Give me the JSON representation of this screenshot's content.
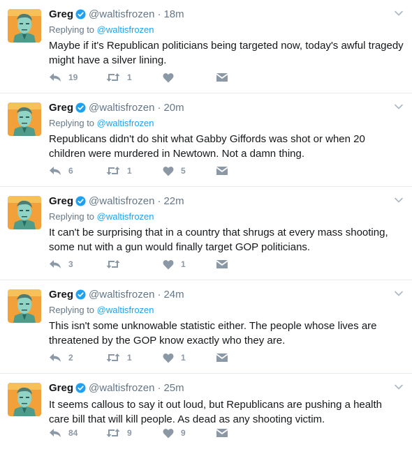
{
  "colors": {
    "link": "#1da1f2",
    "muted": "#657786",
    "action_icon": "#8b98a5",
    "verified": "#1da1f2",
    "divider": "#e6ecf0"
  },
  "tweets": [
    {
      "name": "Greg",
      "handle": "@waltisfrozen",
      "time": "18m",
      "reply_label": "Replying to",
      "reply_to": "@waltisfrozen",
      "text": "Maybe if it's Republican politicians being targeted now, today's awful tragedy might have a silver lining.",
      "replies": "19",
      "retweets": "1",
      "likes": ""
    },
    {
      "name": "Greg",
      "handle": "@waltisfrozen",
      "time": "20m",
      "reply_label": "Replying to",
      "reply_to": "@waltisfrozen",
      "text": "Republicans didn't do shit what Gabby Giffords was shot or when 20 children were murdered in Newtown. Not a damn thing.",
      "replies": "6",
      "retweets": "1",
      "likes": "5"
    },
    {
      "name": "Greg",
      "handle": "@waltisfrozen",
      "time": "22m",
      "reply_label": "Replying to",
      "reply_to": "@waltisfrozen",
      "text": "It can't be surprising that in a country that shrugs at every mass shooting, some nut with a gun would finally target GOP politicians.",
      "replies": "3",
      "retweets": "",
      "likes": "1"
    },
    {
      "name": "Greg",
      "handle": "@waltisfrozen",
      "time": "24m",
      "reply_label": "Replying to",
      "reply_to": "@waltisfrozen",
      "text": "This isn't some unknowable statistic either. The people whose lives are threatened by the GOP know exactly who they are.",
      "replies": "2",
      "retweets": "1",
      "likes": "1"
    },
    {
      "name": "Greg",
      "handle": "@waltisfrozen",
      "time": "25m",
      "text": "It seems callous to say it out loud, but Republicans are pushing a health care bill that will kill people. As dead as any shooting victim.",
      "replies": "84",
      "retweets": "9",
      "likes": "9"
    }
  ]
}
